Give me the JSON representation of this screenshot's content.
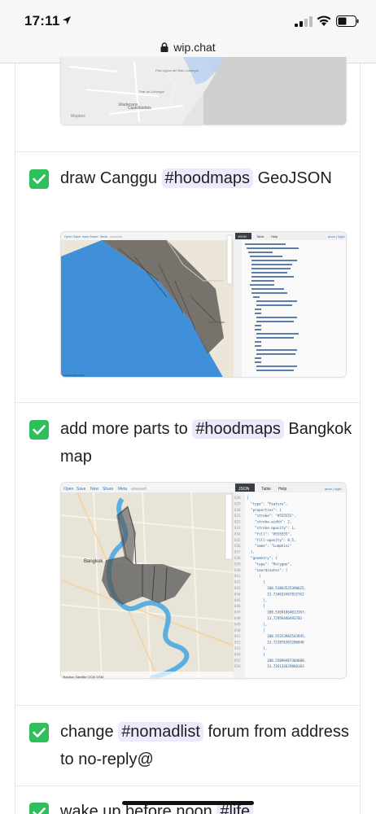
{
  "status_bar": {
    "time": "17:11",
    "icons": [
      "location-arrow-icon",
      "cellular-signal-icon",
      "wifi-icon",
      "battery-icon"
    ]
  },
  "browser": {
    "url": "wip.chat",
    "icons": [
      "lock-icon"
    ]
  },
  "colors": {
    "check_green": "#2fbf5c",
    "tag_bg": "#eaeafc",
    "map_sea": "#4a90e2",
    "map_land": "#e9e4d8",
    "polygon_fill": "#555555"
  },
  "top_map": {
    "labels": [
      "Parc Agrari del Baix Llobregat",
      "Prat de Llobregat",
      "Viladecans",
      "Castelldefels",
      "Mapbox"
    ]
  },
  "feed": [
    {
      "id": "canggu",
      "text_before": "draw Canggu",
      "tag": "#hoodmaps",
      "text_after": "GeoJSON",
      "map": {
        "toolbar": [
          "Open",
          "Save",
          "New",
          "Share",
          "Meta",
          "unsaved"
        ],
        "tabs": [
          "JSON",
          "Table",
          "Help"
        ],
        "login": "anon | login",
        "place_label": "Kerobokan",
        "attribution": "Satellite OSM OSM"
      }
    },
    {
      "id": "bangkok",
      "text_before": "add more parts to",
      "tag": "#hoodmaps",
      "text_after": "Bangkok map",
      "map": {
        "toolbar": [
          "Open",
          "Save",
          "New",
          "Share",
          "Meta",
          "unsaved"
        ],
        "tabs": [
          "JSON",
          "Table",
          "Help"
        ],
        "login": "anon | login",
        "place_label": "Bangkok",
        "attribution": "Mapbox Satellite OCM OSM",
        "code_line_numbers": [
          "828",
          "829",
          "830",
          "831",
          "832",
          "833",
          "834",
          "835",
          "836",
          "837",
          "838",
          "839",
          "840",
          "841",
          "842",
          "843",
          "844",
          "845",
          "846",
          "847",
          "848",
          "849",
          "850",
          "851",
          "852",
          "853",
          "854",
          "855",
          "856"
        ],
        "code_lines": [
          "{",
          "  \"type\": \"Feature\",",
          "  \"properties\": {",
          "    \"stroke\": \"#555555\",",
          "    \"stroke-width\": 2,",
          "    \"stroke-opacity\": 1,",
          "    \"fill\": \"#555555\",",
          "    \"fill-opacity\": 0.5,",
          "    \"name\": \"Lumphini\"",
          "  },",
          "  \"geometry\": {",
          "    \"type\": \"Polygon\",",
          "    \"coordinates\": [",
          "      [",
          "        [",
          "          100.53863525390625,",
          "          13.734632467815762",
          "        ],",
          "        [",
          "          100.53691864013367,",
          "          13.72956446692702",
          "        ],",
          "        [",
          "          100.55253982543945,",
          "          13.722876307206848",
          "        ],",
          "        [",
          "          100.55099487304688,",
          "          13.726132629060103"
        ]
      }
    },
    {
      "id": "nomadlist",
      "text_before": "change",
      "tag": "#nomadlist",
      "text_after": "forum from address to no-reply@"
    },
    {
      "id": "wake",
      "text_before": "wake up before noon",
      "tag": "#life",
      "text_after": ""
    }
  ]
}
